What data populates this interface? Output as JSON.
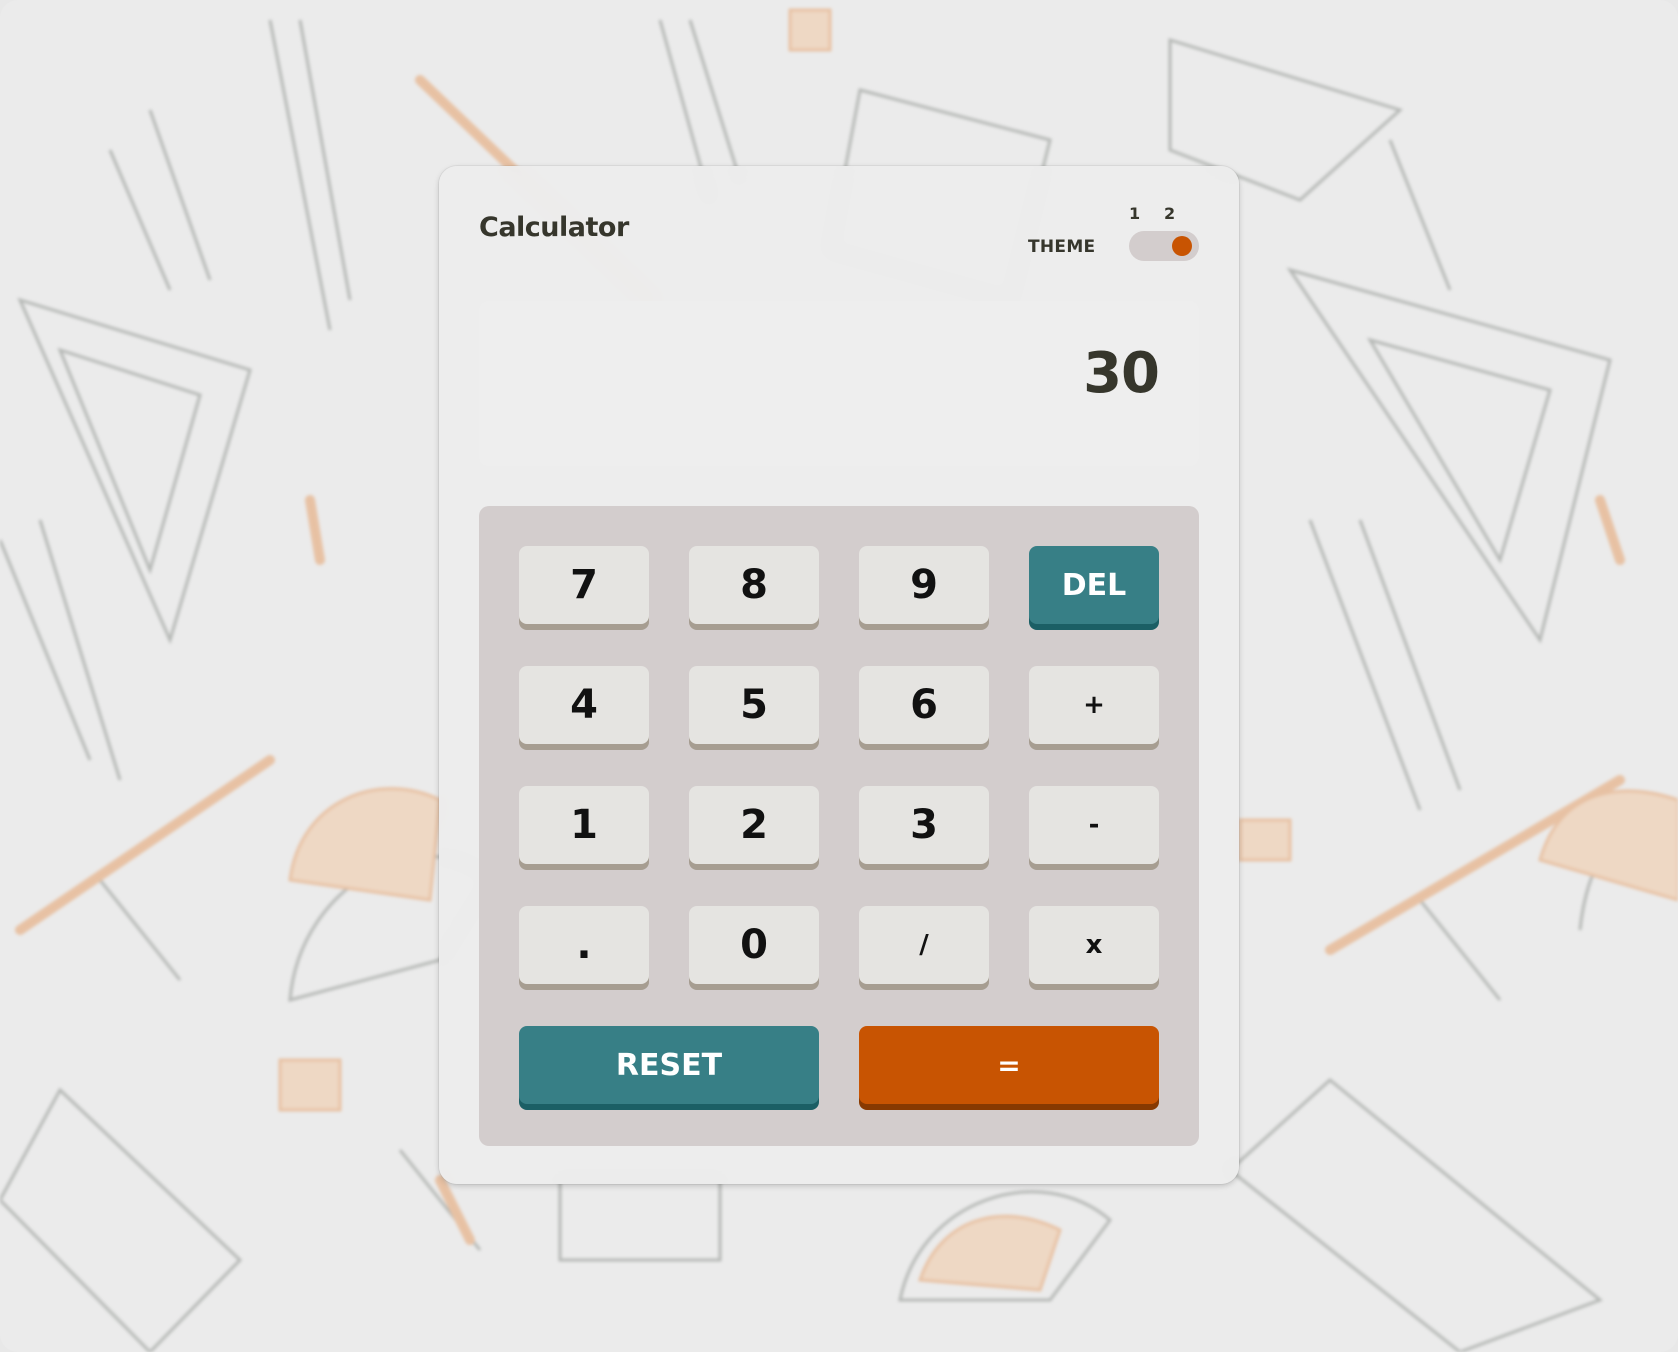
{
  "app": {
    "title": "Calculator"
  },
  "theme": {
    "label": "THEME",
    "options": [
      "1",
      "2"
    ],
    "selected": "2"
  },
  "display": {
    "value": "30"
  },
  "keys": {
    "row1": [
      "7",
      "8",
      "9",
      "DEL"
    ],
    "row2": [
      "4",
      "5",
      "6",
      "+"
    ],
    "row3": [
      "1",
      "2",
      "3",
      "-"
    ],
    "row4": [
      ".",
      "0",
      "/",
      "x"
    ],
    "reset": "RESET",
    "equals": "="
  },
  "colors": {
    "accent_teal": "#377f86",
    "accent_orange": "#c85402",
    "key_bg": "#e5e4e1",
    "keypad_bg": "#d3cdcd",
    "text_dark": "#36362c"
  }
}
